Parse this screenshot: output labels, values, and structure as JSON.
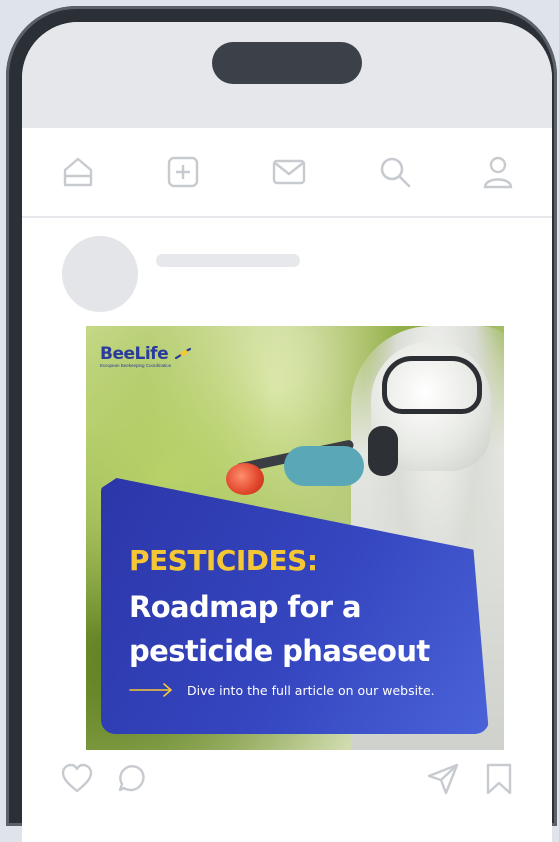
{
  "nav": {
    "items": [
      {
        "id": "home",
        "icon": "home-icon"
      },
      {
        "id": "create",
        "icon": "plus-square-icon"
      },
      {
        "id": "messages",
        "icon": "mail-icon"
      },
      {
        "id": "search",
        "icon": "search-icon"
      },
      {
        "id": "profile",
        "icon": "user-icon"
      }
    ]
  },
  "post": {
    "logo": {
      "wordmark": "BeeLife",
      "tagline": "European Beekeeping Coordination"
    },
    "card": {
      "heading": "PESTICIDES:",
      "title": "Roadmap for a pesticide phaseout",
      "cta": "Dive into the full article on our website."
    },
    "colors": {
      "card": "#2c36a8",
      "heading": "#f6c735",
      "text": "#ffffff",
      "logo": "#2a3b9c"
    }
  },
  "actions": [
    {
      "id": "like",
      "icon": "heart-icon"
    },
    {
      "id": "comment",
      "icon": "comment-icon"
    },
    {
      "id": "share",
      "icon": "send-icon"
    },
    {
      "id": "save",
      "icon": "bookmark-icon"
    }
  ]
}
